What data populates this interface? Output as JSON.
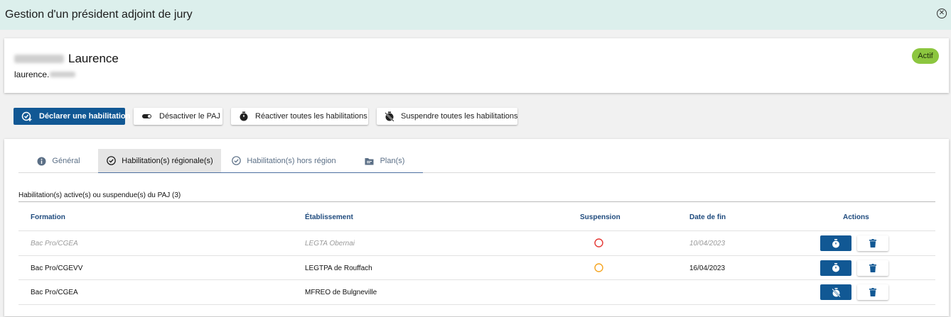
{
  "window": {
    "title": "Gestion d'un président adjoint de jury",
    "close_icon": "close-circle-icon"
  },
  "profile": {
    "first_name": "Laurence",
    "email_prefix": "laurence.",
    "status": "Actif",
    "status_color": "#8cc63f"
  },
  "toolbar": {
    "declare_label": "Déclarer une habilitation",
    "deactivate_label": "Désactiver le PAJ",
    "reactivate_label": "Réactiver toutes les habilitations",
    "suspend_label": "Suspendre toutes les habilitations",
    "primary_color": "#115894"
  },
  "tabs": [
    {
      "label": "Général",
      "icon": "info-icon"
    },
    {
      "label": "Habilitation(s) régionale(s)",
      "icon": "check-circle-icon",
      "active": true
    },
    {
      "label": "Habilitation(s) hors région",
      "icon": "check-circle-icon"
    },
    {
      "label": "Plan(s)",
      "icon": "folder-icon"
    }
  ],
  "section": {
    "title": "Habilitation(s) active(s) ou suspendue(s) du PAJ (3)"
  },
  "table": {
    "headers": [
      "Formation",
      "Établissement",
      "Suspension",
      "Date de fin",
      "Actions"
    ],
    "rows": [
      {
        "formation": "Bac Pro/CGEA",
        "etablissement": "LEGTA Obernai",
        "suspension": "red-half-clock-icon",
        "date_fin": "10/04/2023",
        "state": "inactive"
      },
      {
        "formation": "Bac Pro/CGEVV",
        "etablissement": "LEGTPA de Rouffach",
        "suspension": "orange-half-clock-icon",
        "date_fin": "16/04/2023",
        "state": "active"
      },
      {
        "formation": "Bac Pro/CGEA",
        "etablissement": "MFREO de Bulgneville",
        "suspension": "",
        "date_fin": "",
        "state": "active"
      }
    ]
  }
}
